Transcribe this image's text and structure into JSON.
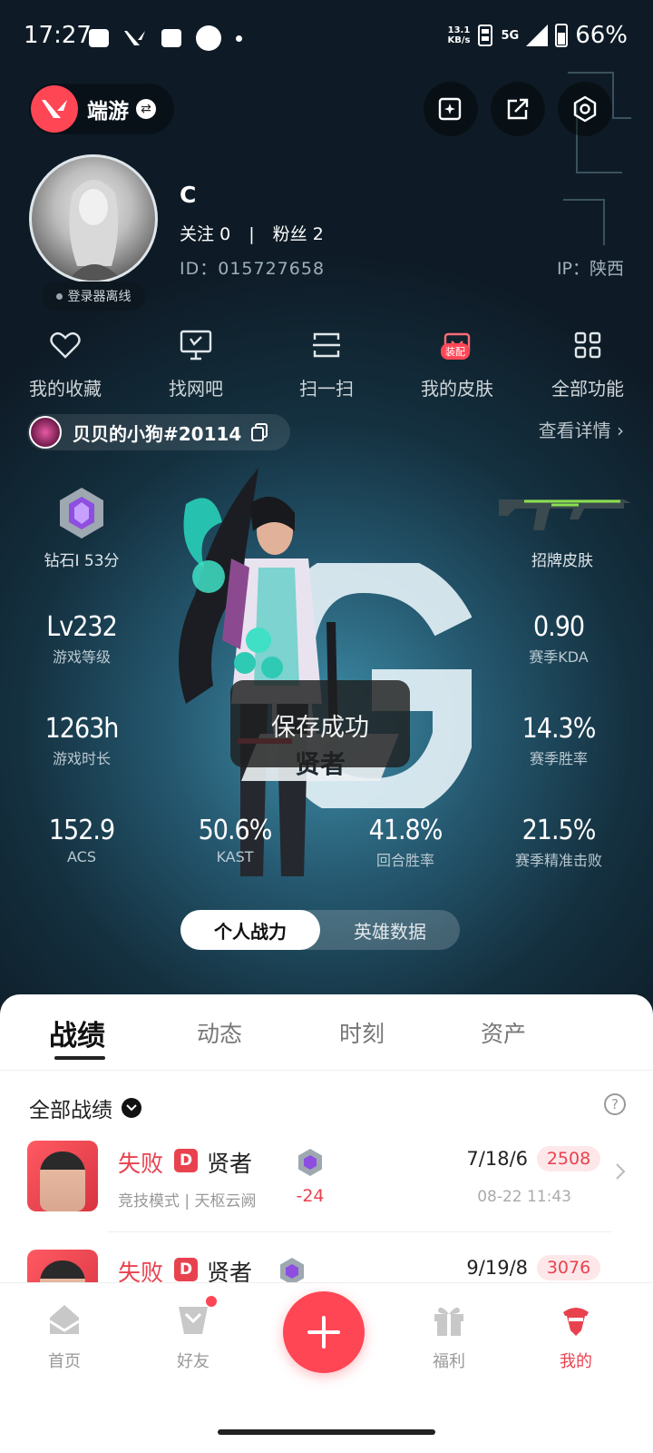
{
  "status_bar": {
    "time": "17:27",
    "net_speed_top": "13.1",
    "net_speed_unit": "KB/s",
    "network": "5G",
    "battery": "66%"
  },
  "header": {
    "app_name": "端游",
    "brand_logo_icon": "valorant-logo-icon"
  },
  "profile": {
    "username": "C",
    "follows_label": "关注",
    "follows_count": "0",
    "fans_label": "粉丝",
    "fans_count": "2",
    "id_text": "ID：015727658",
    "ip_text": "IP：陕西",
    "login_status": "登录器离线"
  },
  "actions": [
    {
      "label": "我的收藏",
      "icon": "heart-icon"
    },
    {
      "label": "找网吧",
      "icon": "monitor-icon"
    },
    {
      "label": "扫一扫",
      "icon": "scan-icon"
    },
    {
      "label": "我的皮肤",
      "icon": "skin-icon",
      "badge": "装配"
    },
    {
      "label": "全部功能",
      "icon": "grid-icon"
    }
  ],
  "player_tag": {
    "name": "贝贝的小狗#20114",
    "detail_link": "查看详情"
  },
  "hero": {
    "rank_label": "钻石I 53分",
    "skin_label": "招牌皮肤",
    "toast": "保存成功",
    "agent_name": "贤者",
    "stats": {
      "level": {
        "value": "Lv232",
        "label": "游戏等级"
      },
      "kda": {
        "value": "0.90",
        "label": "赛季KDA"
      },
      "hours": {
        "value": "1263h",
        "label": "游戏时长"
      },
      "winrate": {
        "value": "14.3%",
        "label": "赛季胜率"
      },
      "acs": {
        "value": "152.9",
        "label": "ACS"
      },
      "kast": {
        "value": "50.6%",
        "label": "KAST"
      },
      "round_winrate": {
        "value": "41.8%",
        "label": "回合胜率"
      },
      "precision": {
        "value": "21.5%",
        "label": "赛季精准击败"
      }
    },
    "segments": {
      "active": "个人战力",
      "inactive": "英雄数据"
    }
  },
  "tabs": [
    "战绩",
    "动态",
    "时刻",
    "资产"
  ],
  "filter": {
    "label": "全部战绩"
  },
  "matches": [
    {
      "result": "失败",
      "grade": "D",
      "agent": "贤者",
      "mode": "竞技模式 | 天枢云阙",
      "delta": "-24",
      "kda": "7/18/6",
      "score": "2508",
      "time": "08-22 11:43"
    },
    {
      "result": "失败",
      "grade": "D",
      "agent": "贤者",
      "mode": "",
      "delta": "",
      "kda": "9/19/8",
      "score": "3076",
      "time": ""
    }
  ],
  "nav": [
    {
      "label": "首页",
      "icon": "home-icon"
    },
    {
      "label": "好友",
      "icon": "friends-icon"
    },
    {
      "label": "福利",
      "icon": "gift-icon"
    },
    {
      "label": "我的",
      "icon": "profile-agent-icon"
    }
  ],
  "colors": {
    "accent": "#ff4655",
    "loss": "#e8424f"
  }
}
